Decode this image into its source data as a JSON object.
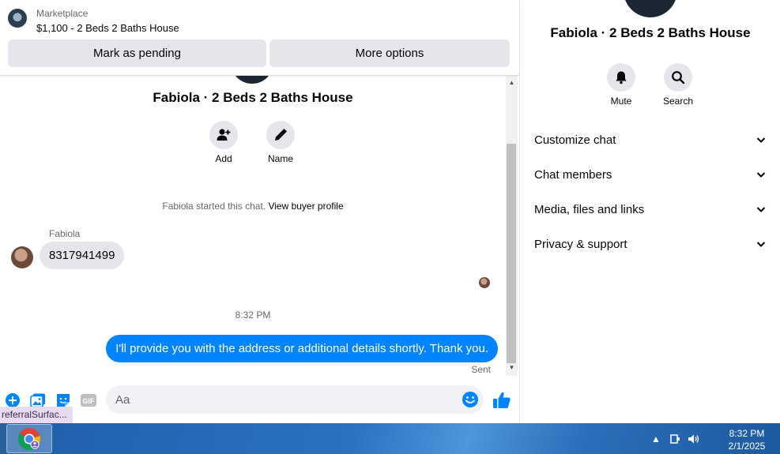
{
  "header": {
    "kicker": "Marketplace",
    "listing_title": "$1,100 - 2 Beds 2 Baths House",
    "pending_label": "Mark as pending",
    "more_label": "More options"
  },
  "thread": {
    "name": "Fabiola · 2 Beds 2 Baths House",
    "actions": [
      {
        "label": "Add",
        "icon": "add-person-icon"
      },
      {
        "label": "Name",
        "icon": "pencil-icon"
      }
    ],
    "system_prefix": "Fabiola started this chat.",
    "system_link": "View buyer profile",
    "incoming_sender": "Fabiola",
    "incoming_text": "8317941499",
    "timestamp": "8:32 PM",
    "outgoing_text": "I'll provide you with the address or additional details shortly. Thank you.",
    "sent_status": "Sent"
  },
  "composer": {
    "placeholder": "Aa",
    "value": "",
    "gif_label": "GIF",
    "tooltip": "referralSurfac..."
  },
  "info_panel": {
    "name": "Fabiola · 2 Beds 2 Baths House",
    "actions": [
      {
        "label": "Mute",
        "icon": "bell-icon"
      },
      {
        "label": "Search",
        "icon": "search-icon"
      }
    ],
    "sections": [
      "Customize chat",
      "Chat members",
      "Media, files and links",
      "Privacy & support"
    ]
  },
  "taskbar": {
    "app": "chrome-icon",
    "clock_time": "8:32 PM",
    "clock_date": "2/1/2025"
  },
  "colors": {
    "accent": "#0084ff",
    "bubble_incoming": "#e4e6eb",
    "button_bg": "#e4e6eb",
    "taskbar": "#2a73c2"
  }
}
